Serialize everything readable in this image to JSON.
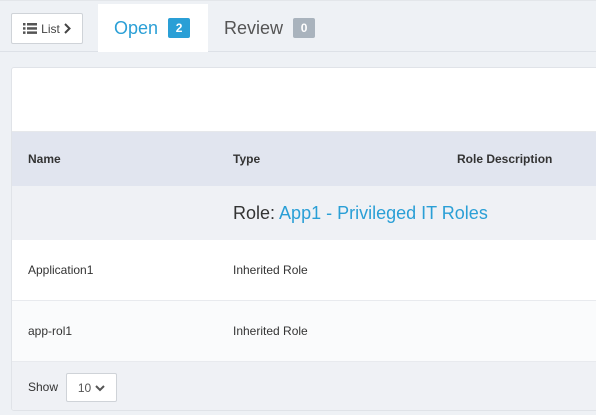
{
  "toolbar": {
    "list_label": "List",
    "list_icon": "list-icon",
    "chevron_icon": "chevron-right-icon"
  },
  "tabs": [
    {
      "label": "Open",
      "count": "2",
      "active": true
    },
    {
      "label": "Review",
      "count": "0",
      "active": false
    }
  ],
  "table": {
    "columns": [
      "Name",
      "Type",
      "Role Description"
    ],
    "group": {
      "prefix": "Role:",
      "name": "App1 - Privileged IT Roles"
    },
    "rows": [
      {
        "name": "Application1",
        "type": "Inherited Role",
        "description": ""
      },
      {
        "name": "app-rol1",
        "type": "Inherited Role",
        "description": ""
      }
    ]
  },
  "footer": {
    "show_label": "Show",
    "page_size": "10"
  },
  "colors": {
    "accent": "#2a9fd6",
    "badge_inactive": "#a9b3bd",
    "header_bg": "#e1e5ef"
  }
}
